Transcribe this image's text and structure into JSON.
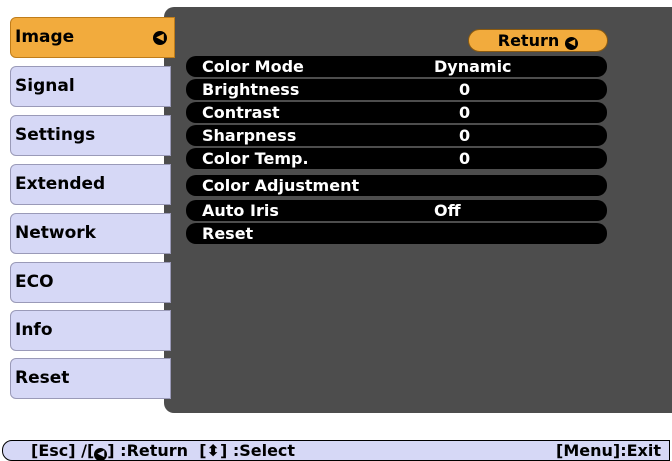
{
  "tabs": [
    {
      "label": "Image",
      "active": true
    },
    {
      "label": "Signal"
    },
    {
      "label": "Settings"
    },
    {
      "label": "Extended"
    },
    {
      "label": "Network"
    },
    {
      "label": "ECO"
    },
    {
      "label": "Info"
    },
    {
      "label": "Reset"
    }
  ],
  "return_button": {
    "label": "Return"
  },
  "menu": [
    {
      "label": "Color Mode",
      "value": "Dynamic"
    },
    {
      "label": "Brightness",
      "value": "0"
    },
    {
      "label": "Contrast",
      "value": "0"
    },
    {
      "label": "Sharpness",
      "value": "0"
    },
    {
      "label": "Color Temp.",
      "value": "0"
    },
    {
      "label": "Color Adjustment",
      "value": ""
    },
    {
      "label": "Auto Iris",
      "value": "Off"
    },
    {
      "label": "Reset",
      "value": ""
    }
  ],
  "footer": {
    "esc": "[Esc] /[",
    "return": "] :Return",
    "select": "[",
    "select_label": "] :Select",
    "menu_exit": "[Menu]:Exit"
  },
  "icons": {
    "enter": "enter-icon",
    "updown": "up-down-arrow-icon"
  },
  "colors": {
    "active_tab": "#f2ab3d",
    "tab": "#d6d8f6",
    "panel": "#4d4d4d",
    "menu_row": "#000000"
  }
}
